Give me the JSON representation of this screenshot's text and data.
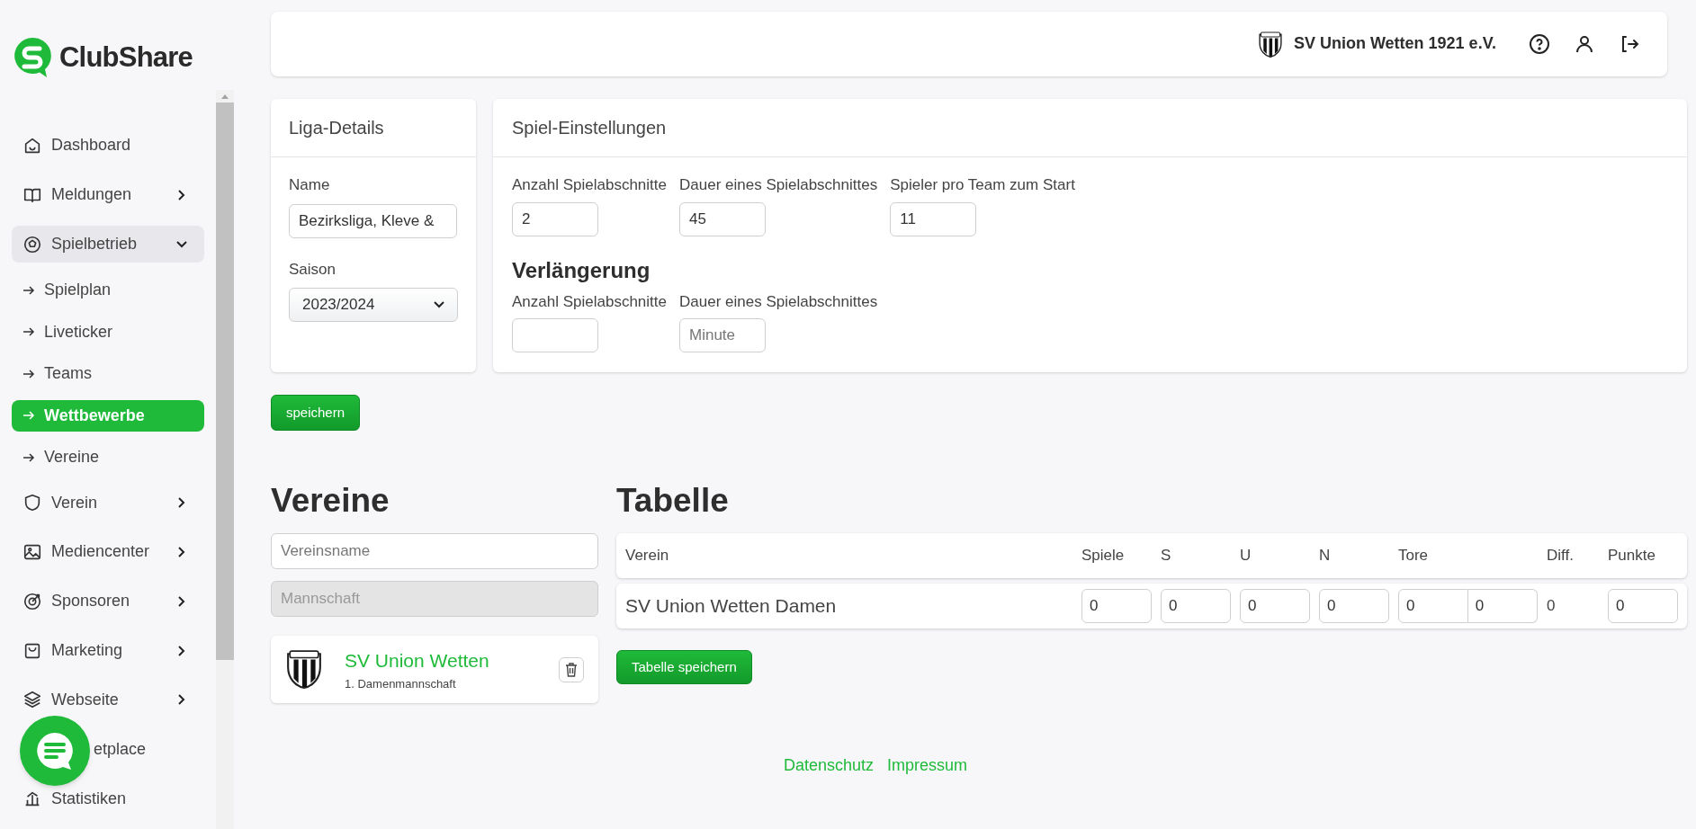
{
  "logo": {
    "name": "ClubShare"
  },
  "sidebar": {
    "items": [
      {
        "label": "Dashboard",
        "kind": "link",
        "selected": false
      },
      {
        "label": "Meldungen",
        "kind": "group",
        "expanded": false,
        "selected": false
      },
      {
        "label": "Spielbetrieb",
        "kind": "group",
        "expanded": true,
        "selected": true,
        "children": [
          {
            "label": "Spielplan",
            "selected": false
          },
          {
            "label": "Liveticker",
            "selected": false
          },
          {
            "label": "Teams",
            "selected": false
          },
          {
            "label": "Wettbewerbe",
            "selected": true
          },
          {
            "label": "Vereine",
            "selected": false
          }
        ]
      },
      {
        "label": "Verein",
        "kind": "group",
        "expanded": false,
        "selected": false
      },
      {
        "label": "Mediencenter",
        "kind": "group",
        "expanded": false,
        "selected": false
      },
      {
        "label": "Sponsoren",
        "kind": "group",
        "expanded": false,
        "selected": false
      },
      {
        "label": "Marketing",
        "kind": "group",
        "expanded": false,
        "selected": false
      },
      {
        "label": "Webseite",
        "kind": "group",
        "expanded": false,
        "selected": false
      },
      {
        "label": "etplace",
        "kind": "covered",
        "selected": false
      },
      {
        "label": "Statistiken",
        "kind": "link",
        "selected": false
      }
    ]
  },
  "header": {
    "club_name": "SV Union Wetten 1921 e.V."
  },
  "liga_details": {
    "title": "Liga-Details",
    "fields": [
      {
        "label": "Name",
        "value": "Bezirksliga, Kleve &",
        "kind": "text"
      },
      {
        "label": "Saison",
        "value": "2023/2024",
        "kind": "select"
      }
    ]
  },
  "spiel_einstellungen": {
    "title": "Spiel-Einstellungen",
    "fields": [
      {
        "label": "Anzahl Spielabschnitte",
        "value": "2"
      },
      {
        "label": "Dauer eines Spielabschnittes",
        "value": "45"
      },
      {
        "label": "Spieler pro Team zum Start",
        "value": "11"
      }
    ],
    "verlaengerung": {
      "title": "Verlängerung",
      "fields": [
        {
          "label": "Anzahl Spielabschnitte"
        },
        {
          "label": "Dauer eines Spielabschnittes",
          "placeholder": "Minute"
        }
      ]
    }
  },
  "save_button": "speichern",
  "vereine": {
    "title": "Vereine",
    "search": {
      "placeholder": "Vereinsname"
    },
    "team_field": {
      "placeholder": "Mannschaft",
      "disabled": true
    },
    "clubs": [
      {
        "name": "SV Union Wetten",
        "team": "1. Damenmannschaft"
      }
    ]
  },
  "tabelle": {
    "title": "Tabelle",
    "columns": [
      "Verein",
      "Spiele",
      "S",
      "U",
      "N",
      "Tore",
      "Diff.",
      "Punkte"
    ],
    "rows": [
      {
        "verein": "SV Union Wetten Damen",
        "spiele": "0",
        "s": "0",
        "u": "0",
        "n": "0",
        "tore_for": "0",
        "tore_against": "0",
        "diff": "0",
        "punkte": "0"
      }
    ],
    "save_button": "Tabelle speichern"
  },
  "footer": {
    "links": [
      "Datenschutz",
      "Impressum"
    ]
  }
}
